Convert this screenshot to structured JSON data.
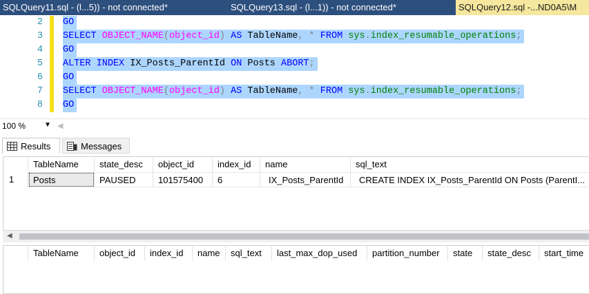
{
  "tabs": [
    {
      "label": "SQLQuery11.sql - (l...5)) - not connected*",
      "active": false
    },
    {
      "label": "SQLQuery13.sql - (l...1)) - not connected*",
      "active": false
    },
    {
      "label": "SQLQuery12.sql -...ND0A5\\M",
      "active": true
    }
  ],
  "editor": {
    "line_numbers": [
      "2",
      "3",
      "4",
      "5",
      "6",
      "7",
      "8"
    ],
    "lines": {
      "l2": {
        "go": "GO"
      },
      "l3": {
        "select": "SELECT",
        "fn": "OBJECT_NAME",
        "paren_open": "(",
        "arg": "object_id",
        "paren_close": ")",
        "as": "AS",
        "alias": "TableName",
        "comma": ",",
        "star": "*",
        "from": "FROM",
        "schema": "sys",
        "dot": ".",
        "obj": "index_resumable_operations",
        "semi": ";"
      },
      "l4": {
        "go": "GO"
      },
      "l5": {
        "alter": "ALTER",
        "index": "INDEX",
        "name": "IX_Posts_ParentId",
        "on": "ON",
        "table": "Posts",
        "abort": "ABORT",
        "semi": ";"
      },
      "l6": {
        "go": "GO"
      },
      "l7": {
        "select": "SELECT",
        "fn": "OBJECT_NAME",
        "paren_open": "(",
        "arg": "object_id",
        "paren_close": ")",
        "as": "AS",
        "alias": "TableName",
        "comma": ",",
        "star": "*",
        "from": "FROM",
        "schema": "sys",
        "dot": ".",
        "obj": "index_resumable_operations",
        "semi": ";"
      },
      "l8": {
        "go": "GO"
      }
    }
  },
  "zoom": {
    "value": "100 %"
  },
  "result_tabs": {
    "results": "Results",
    "messages": "Messages"
  },
  "grid1": {
    "columns": [
      "TableName",
      "state_desc",
      "object_id",
      "index_id",
      "name",
      "sql_text"
    ],
    "rows": [
      {
        "num": "1",
        "cells": [
          "Posts",
          "PAUSED",
          "101575400",
          "6",
          "IX_Posts_ParentId",
          "CREATE INDEX IX_Posts_ParentId ON Posts (ParentI..."
        ]
      }
    ]
  },
  "grid2": {
    "columns": [
      "TableName",
      "object_id",
      "index_id",
      "name",
      "sql_text",
      "last_max_dop_used",
      "partition_number",
      "state",
      "state_desc",
      "start_time"
    ]
  },
  "colors": {
    "tab_bar": "#2d4f7d",
    "active_tab": "#f5e79e",
    "selection": "#add6ff",
    "keyword": "#0000ff",
    "function": "#ff00ff",
    "system_object": "#008000",
    "line_number": "#2b91af"
  }
}
